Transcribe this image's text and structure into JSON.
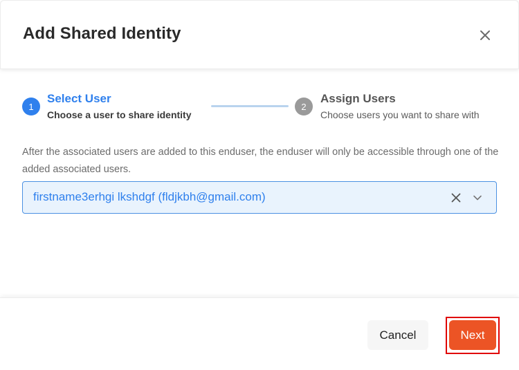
{
  "dialog": {
    "title": "Add Shared Identity",
    "close_icon": "close-icon"
  },
  "stepper": {
    "steps": [
      {
        "number": "1",
        "title": "Select User",
        "subtitle": "Choose a user to share identity",
        "state": "active",
        "color": "#2f80ed"
      },
      {
        "number": "2",
        "title": "Assign Users",
        "subtitle": "Choose users you want to share with",
        "state": "inactive",
        "color": "#9a9a9a"
      }
    ]
  },
  "description": "After the associated users are added to this enduser, the enduser will only be accessible through one of the added associated users.",
  "user_select": {
    "value": "firstname3erhgi lkshdgf (fldjkbh@gmail.com)",
    "clear_icon": "close-icon",
    "dropdown_icon": "chevron-down-icon"
  },
  "footer": {
    "cancel_label": "Cancel",
    "next_label": "Next"
  },
  "colors": {
    "accent": "#2f80ed",
    "primary_button": "#ec5425",
    "highlight": "#e00000"
  }
}
